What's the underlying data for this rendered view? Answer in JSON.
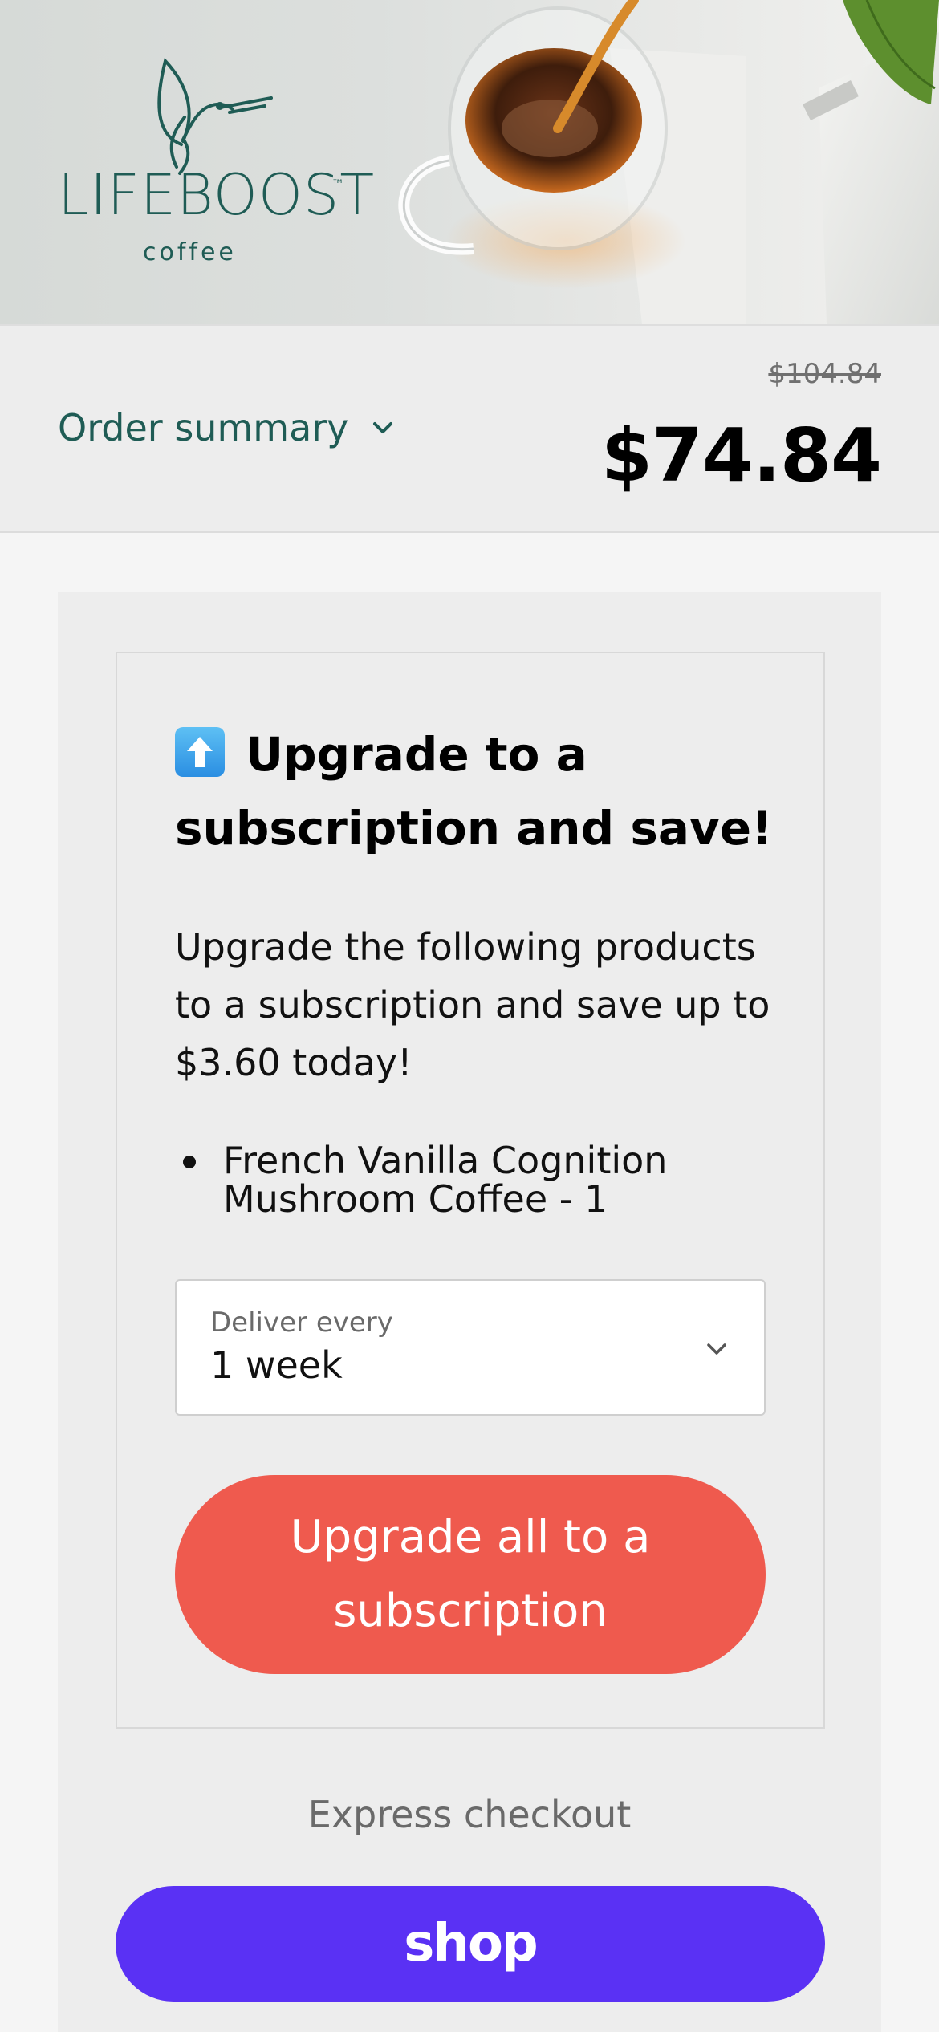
{
  "brand": {
    "name": "LIFEBOOST",
    "trademark": "™",
    "tagline": "coffee",
    "logo_color": "#1f5c55"
  },
  "summary": {
    "label": "Order summary",
    "toggle_icon": "chevron-down-icon",
    "original_price": "$104.84",
    "total_price": "$74.84"
  },
  "upsell": {
    "title_icon": "up-arrow-emoji",
    "title": "Upgrade to a subscription and save!",
    "description": "Upgrade the following products to a subscription and save up to $3.60 today!",
    "products": [
      {
        "name": "French Vanilla Cognition Mushroom Coffee - 1"
      }
    ],
    "frequency": {
      "label": "Deliver every",
      "value": "1 week"
    },
    "button_label": "Upgrade all to a subscription",
    "button_color": "#ef5a4e"
  },
  "express": {
    "label": "Express checkout",
    "shop_label": "shop",
    "shop_color": "#5a31f4"
  }
}
